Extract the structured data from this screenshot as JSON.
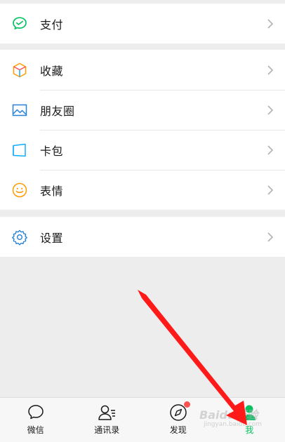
{
  "menu": {
    "payment": "支付",
    "favorites": "收藏",
    "moments": "朋友圈",
    "cards": "卡包",
    "stickers": "表情",
    "settings": "设置"
  },
  "tabbar": {
    "chats": "微信",
    "contacts": "通讯录",
    "discover": "发现",
    "me": "我"
  },
  "watermark": {
    "brand": "Baidu经验",
    "url": "jingyan.baidu.com"
  },
  "colors": {
    "accent": "#07c160",
    "background": "#ededed",
    "badge": "#fa5151",
    "annotation_arrow": "#ff1a1a"
  }
}
